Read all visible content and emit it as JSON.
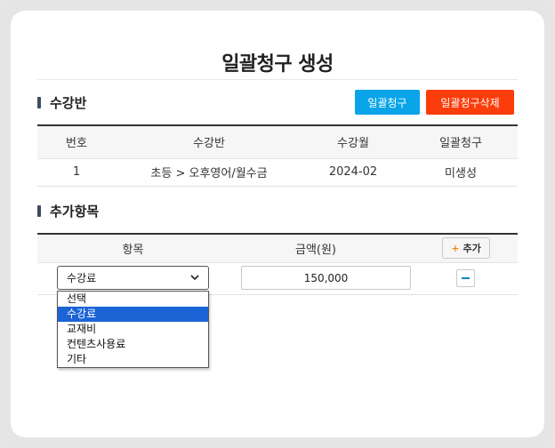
{
  "page": {
    "title": "일괄청구 생성"
  },
  "section1": {
    "title": "수강반",
    "bulk_claim_button": "일괄청구",
    "bulk_claim_delete_button": "일괄청구삭제",
    "columns": [
      "번호",
      "수강반",
      "수강월",
      "일괄청구"
    ],
    "rows": [
      {
        "no": "1",
        "class": "초등 > 오후영어/월수금",
        "month": "2024-02",
        "status": "미생성"
      }
    ]
  },
  "section2": {
    "title": "추가항목",
    "columns": {
      "item": "항목",
      "amount": "금액(원)"
    },
    "add_button": "추가",
    "rows": [
      {
        "item": "수강료",
        "amount": "150,000"
      }
    ],
    "dropdown_options": [
      "선택",
      "수강료",
      "교재비",
      "컨텐츠사용료",
      "기타"
    ],
    "selected_option": "수강료"
  },
  "colors": {
    "accent_blue": "#0aa5e8",
    "accent_red": "#fb3d0b",
    "selected_option_bg": "#1a64d6"
  }
}
